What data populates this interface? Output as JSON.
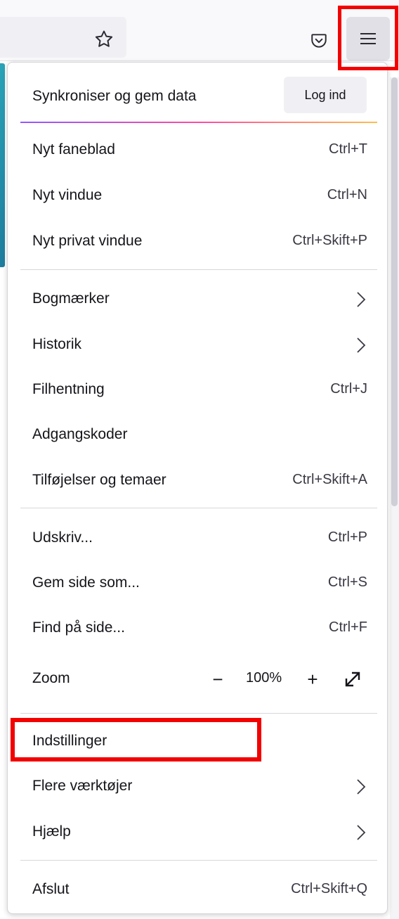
{
  "toolbar": {
    "bookmark_icon": "star-icon",
    "pocket_icon": "pocket-icon",
    "menu_icon": "hamburger-menu-icon"
  },
  "sync": {
    "label": "Synkroniser og gem data",
    "login_button": "Log ind"
  },
  "menu": {
    "new_tab": {
      "label": "Nyt faneblad",
      "shortcut": "Ctrl+T"
    },
    "new_window": {
      "label": "Nyt vindue",
      "shortcut": "Ctrl+N"
    },
    "new_private": {
      "label": "Nyt privat vindue",
      "shortcut": "Ctrl+Skift+P"
    },
    "bookmarks": {
      "label": "Bogmærker"
    },
    "history": {
      "label": "Historik"
    },
    "downloads": {
      "label": "Filhentning",
      "shortcut": "Ctrl+J"
    },
    "passwords": {
      "label": "Adgangskoder"
    },
    "addons": {
      "label": "Tilføjelser og temaer",
      "shortcut": "Ctrl+Skift+A"
    },
    "print": {
      "label": "Udskriv...",
      "shortcut": "Ctrl+P"
    },
    "save_page": {
      "label": "Gem side som...",
      "shortcut": "Ctrl+S"
    },
    "find": {
      "label": "Find på side...",
      "shortcut": "Ctrl+F"
    },
    "zoom": {
      "label": "Zoom",
      "value": "100%",
      "decrease": "−",
      "increase": "+"
    },
    "settings": {
      "label": "Indstillinger"
    },
    "more_tools": {
      "label": "Flere værktøjer"
    },
    "help": {
      "label": "Hjælp"
    },
    "quit": {
      "label": "Afslut",
      "shortcut": "Ctrl+Skift+Q"
    }
  },
  "colors": {
    "highlight": "#f30000",
    "panel_bg": "#ffffff",
    "toolbar_bg": "#f9f9fb"
  }
}
